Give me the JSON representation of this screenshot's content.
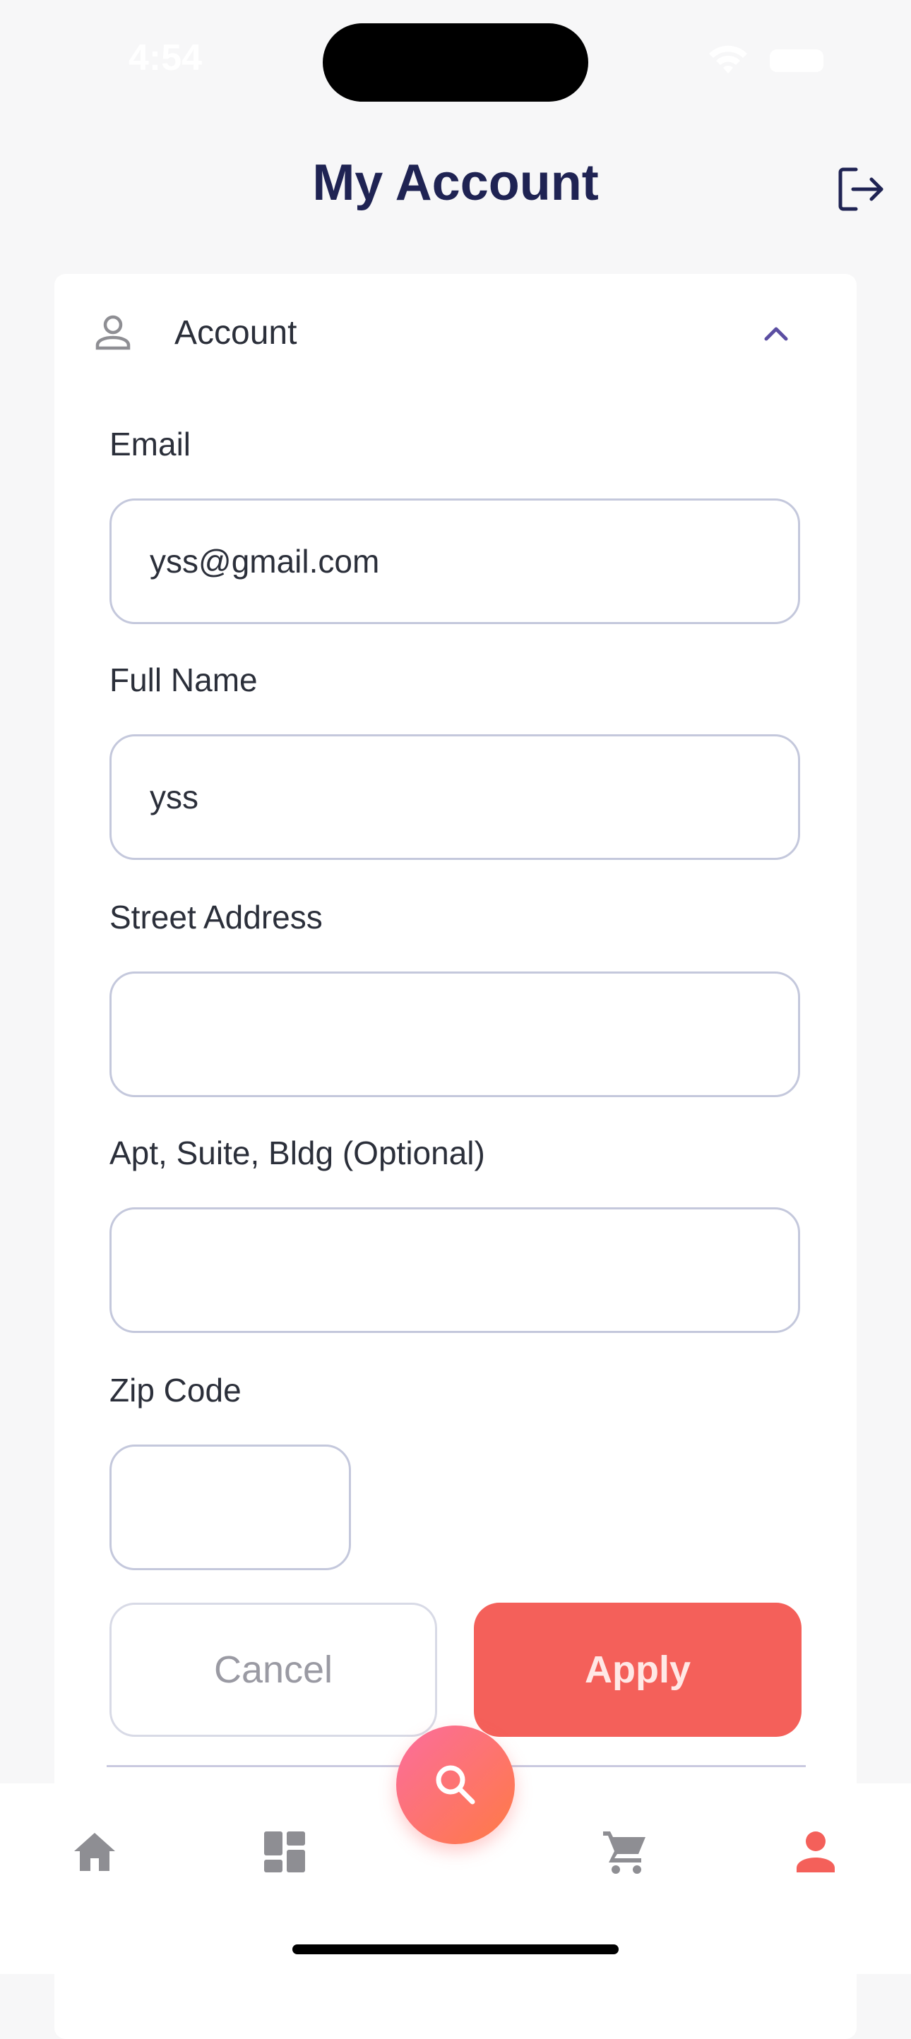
{
  "status_bar": {
    "time": "4:54"
  },
  "header": {
    "title": "My Account"
  },
  "account_section": {
    "label": "Account",
    "fields": {
      "email": {
        "label": "Email",
        "value": "yss@gmail.com"
      },
      "full_name": {
        "label": "Full Name",
        "value": "yss"
      },
      "street_address": {
        "label": "Street Address",
        "value": ""
      },
      "apt": {
        "label": "Apt, Suite, Bldg (Optional)",
        "value": ""
      },
      "zip": {
        "label": "Zip Code",
        "value": ""
      }
    },
    "cancel_label": "Cancel",
    "apply_label": "Apply"
  },
  "tabbar": {
    "items": [
      {
        "name": "home",
        "icon": "home-icon",
        "active": false
      },
      {
        "name": "dashboard",
        "icon": "dashboard-icon",
        "active": false
      },
      {
        "name": "search",
        "icon": "search-icon",
        "active": false
      },
      {
        "name": "cart",
        "icon": "cart-icon",
        "active": false
      },
      {
        "name": "profile",
        "icon": "person-icon",
        "active": true
      }
    ]
  },
  "colors": {
    "title": "#1f2353",
    "accent": "#f4605a",
    "fab_gradient_start": "#fb6d9d",
    "fab_gradient_end": "#ff7a45",
    "chevron": "#5b4ea2",
    "tab_inactive": "#8e8e93",
    "tab_active": "#f4605a"
  }
}
